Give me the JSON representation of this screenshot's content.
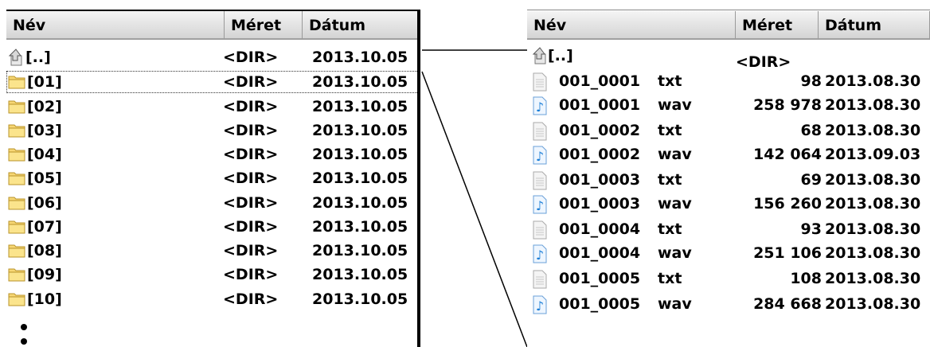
{
  "left_panel": {
    "headers": {
      "name": "Név",
      "size": "Méret",
      "date": "Dátum"
    },
    "rows": [
      {
        "name": "[..]",
        "size": "<DIR>",
        "date": "2013.10.05",
        "icon": "up-arrow-icon"
      },
      {
        "name": "[01]",
        "size": "<DIR>",
        "date": "2013.10.05",
        "icon": "folder-icon"
      },
      {
        "name": "[02]",
        "size": "<DIR>",
        "date": "2013.10.05",
        "icon": "folder-icon"
      },
      {
        "name": "[03]",
        "size": "<DIR>",
        "date": "2013.10.05",
        "icon": "folder-icon"
      },
      {
        "name": "[04]",
        "size": "<DIR>",
        "date": "2013.10.05",
        "icon": "folder-icon"
      },
      {
        "name": "[05]",
        "size": "<DIR>",
        "date": "2013.10.05",
        "icon": "folder-icon"
      },
      {
        "name": "[06]",
        "size": "<DIR>",
        "date": "2013.10.05",
        "icon": "folder-icon"
      },
      {
        "name": "[07]",
        "size": "<DIR>",
        "date": "2013.10.05",
        "icon": "folder-icon"
      },
      {
        "name": "[08]",
        "size": "<DIR>",
        "date": "2013.10.05",
        "icon": "folder-icon"
      },
      {
        "name": "[09]",
        "size": "<DIR>",
        "date": "2013.10.05",
        "icon": "folder-icon"
      },
      {
        "name": "[10]",
        "size": "<DIR>",
        "date": "2013.10.05",
        "icon": "folder-icon"
      }
    ]
  },
  "right_panel": {
    "headers": {
      "name": "Név",
      "size": "Méret",
      "date": "Dátum"
    },
    "rows": [
      {
        "name": "[..]",
        "ext": "",
        "size": "<DIR>",
        "date": "",
        "icon": "up-arrow-icon"
      },
      {
        "name": "001_0001",
        "ext": "txt",
        "size": "98",
        "date": "2013.08.30",
        "icon": "text-file-icon"
      },
      {
        "name": "001_0001",
        "ext": "wav",
        "size": "258 978",
        "date": "2013.08.30",
        "icon": "audio-file-icon"
      },
      {
        "name": "001_0002",
        "ext": "txt",
        "size": "68",
        "date": "2013.08.30",
        "icon": "text-file-icon"
      },
      {
        "name": "001_0002",
        "ext": "wav",
        "size": "142 064",
        "date": "2013.09.03",
        "icon": "audio-file-icon"
      },
      {
        "name": "001_0003",
        "ext": "txt",
        "size": "69",
        "date": "2013.08.30",
        "icon": "text-file-icon"
      },
      {
        "name": "001_0003",
        "ext": "wav",
        "size": "156 260",
        "date": "2013.08.30",
        "icon": "audio-file-icon"
      },
      {
        "name": "001_0004",
        "ext": "txt",
        "size": "93",
        "date": "2013.08.30",
        "icon": "text-file-icon"
      },
      {
        "name": "001_0004",
        "ext": "wav",
        "size": "251 106",
        "date": "2013.08.30",
        "icon": "audio-file-icon"
      },
      {
        "name": "001_0005",
        "ext": "txt",
        "size": "108",
        "date": "2013.08.30",
        "icon": "text-file-icon"
      },
      {
        "name": "001_0005",
        "ext": "wav",
        "size": "284 668",
        "date": "2013.08.30",
        "icon": "audio-file-icon"
      }
    ]
  }
}
